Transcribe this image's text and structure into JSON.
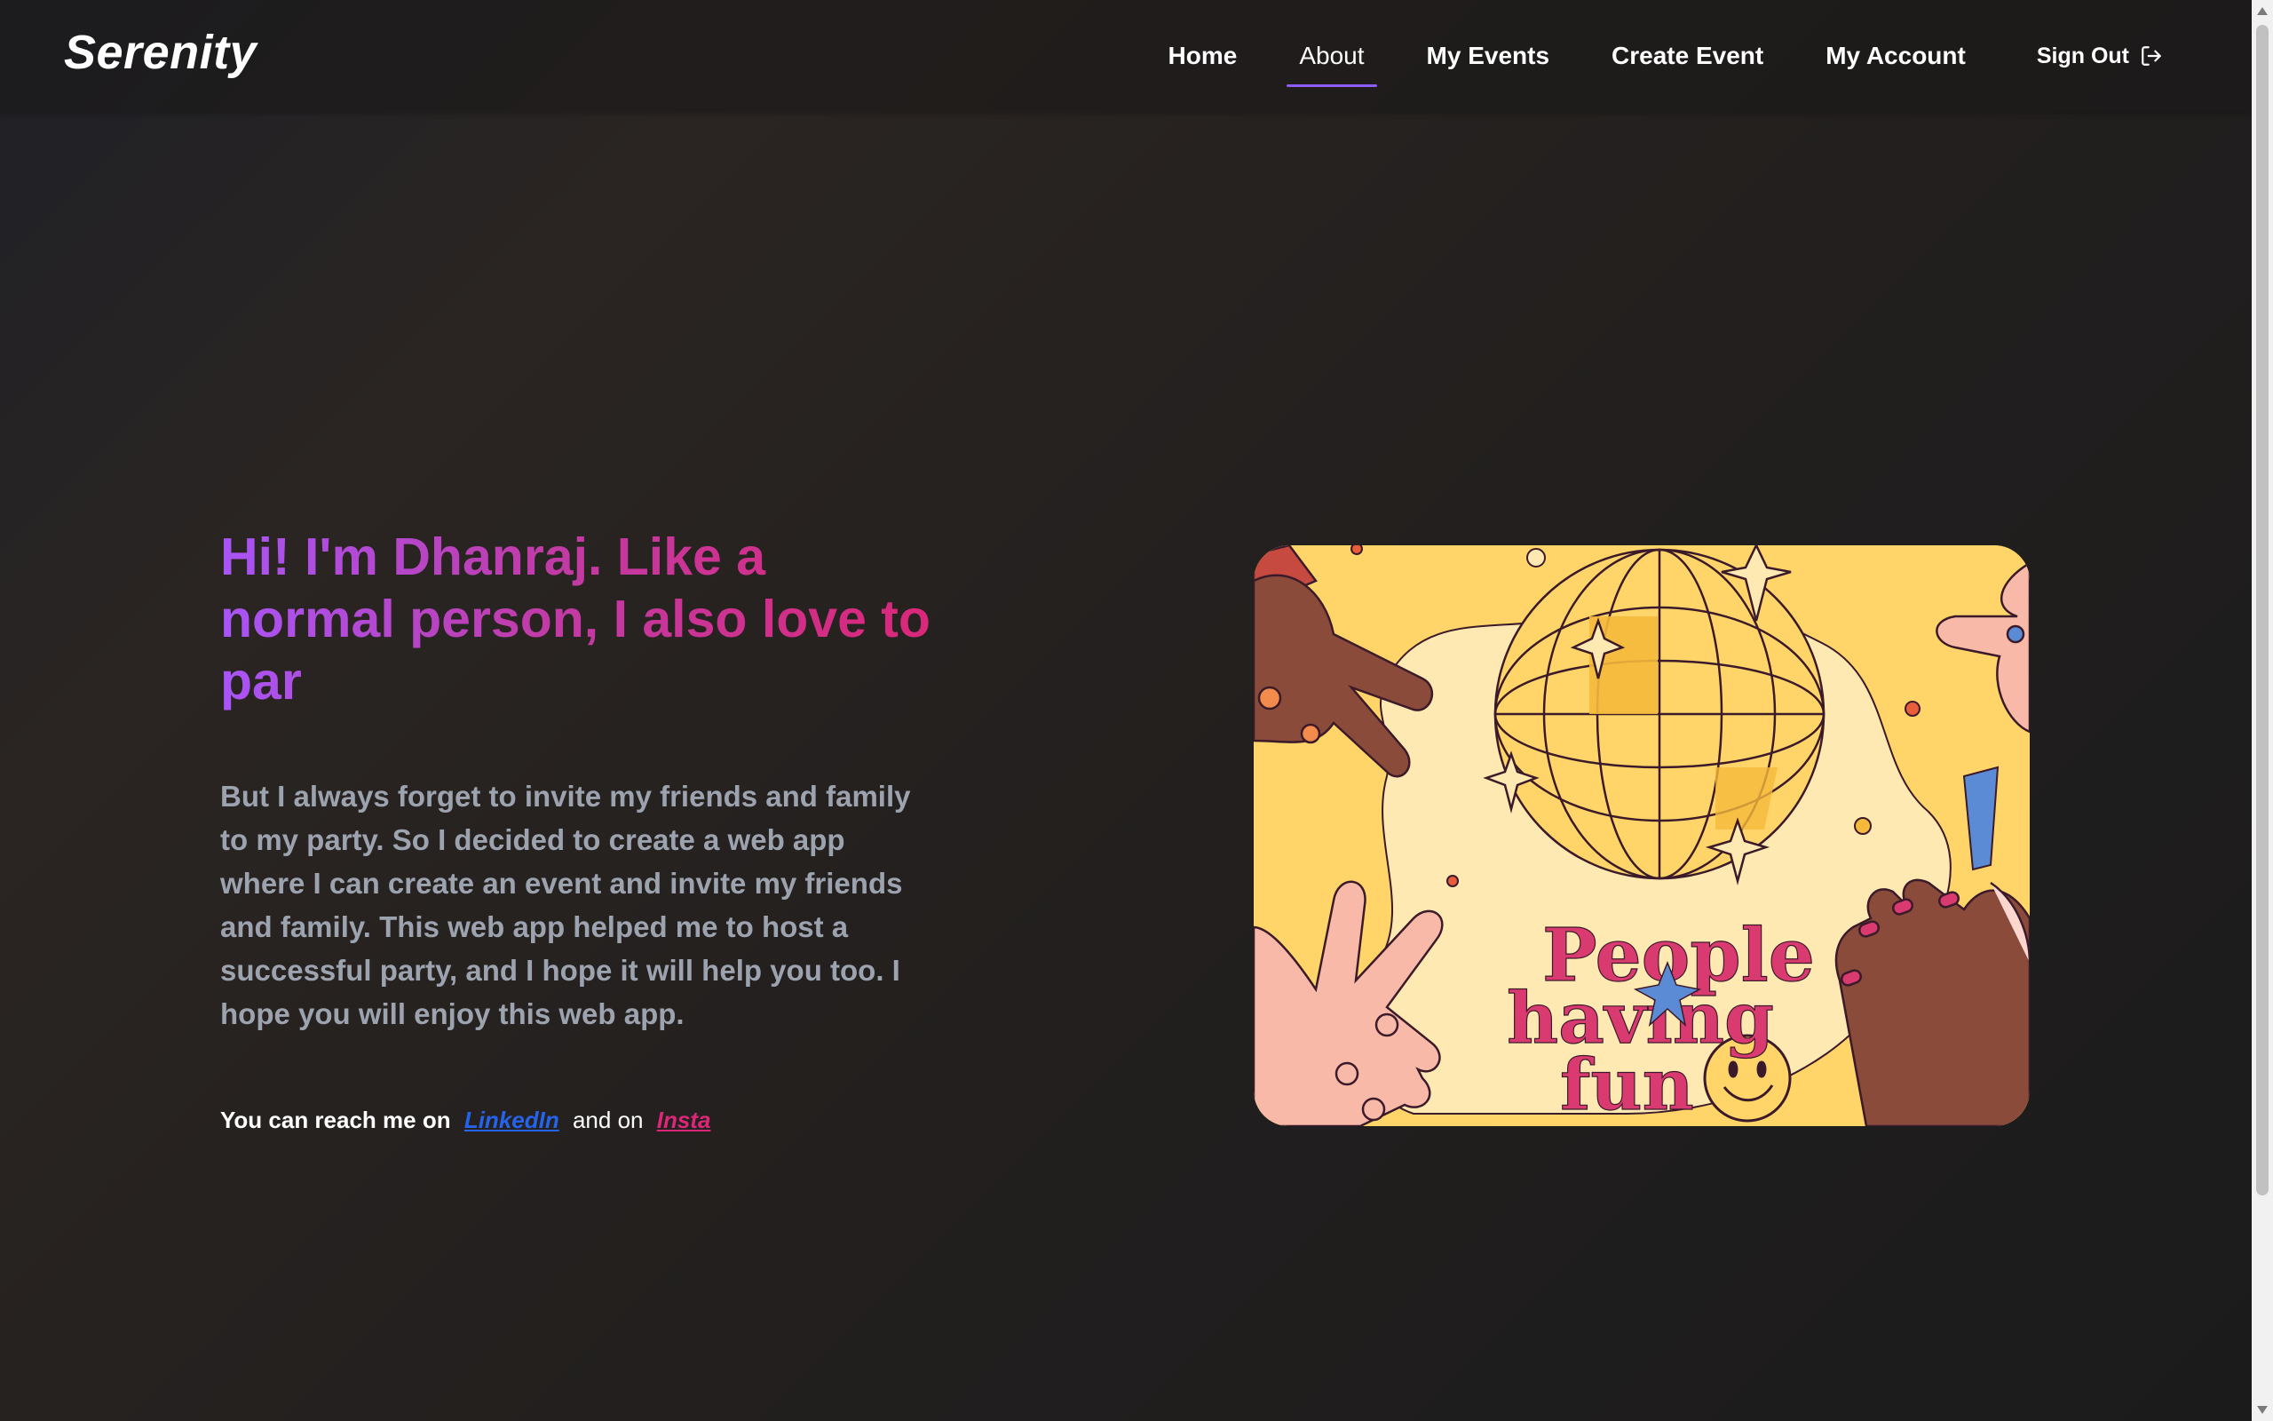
{
  "brand": "Serenity",
  "nav": {
    "items": [
      {
        "label": "Home",
        "active": false
      },
      {
        "label": "About",
        "active": true
      },
      {
        "label": "My Events",
        "active": false
      },
      {
        "label": "Create Event",
        "active": false
      },
      {
        "label": "My Account",
        "active": false
      }
    ],
    "signout_label": "Sign Out",
    "signout_icon": "sign-out-icon",
    "active_underline_color": "#8b5cf6"
  },
  "hero": {
    "title": "Hi! I'm Dhanraj. Like a normal person, I also love to par",
    "title_gradient": [
      "#a855f7",
      "#db2777"
    ],
    "paragraph": "But I always forget to invite my friends and family to my party. So I decided to create a web app where I can create an event and invite my friends and family. This web app helped me to host a successful party, and I hope it will help you too. I hope you will enjoy this web app.",
    "reach": {
      "prefix": "You can reach me on",
      "linkedin_label": "LinkedIn",
      "middle": "and on",
      "insta_label": "Insta",
      "linkedin_color": "#2563eb",
      "insta_color": "#db2777"
    }
  },
  "illustration": {
    "line1": "People",
    "line2": "having",
    "line3": "fun"
  }
}
